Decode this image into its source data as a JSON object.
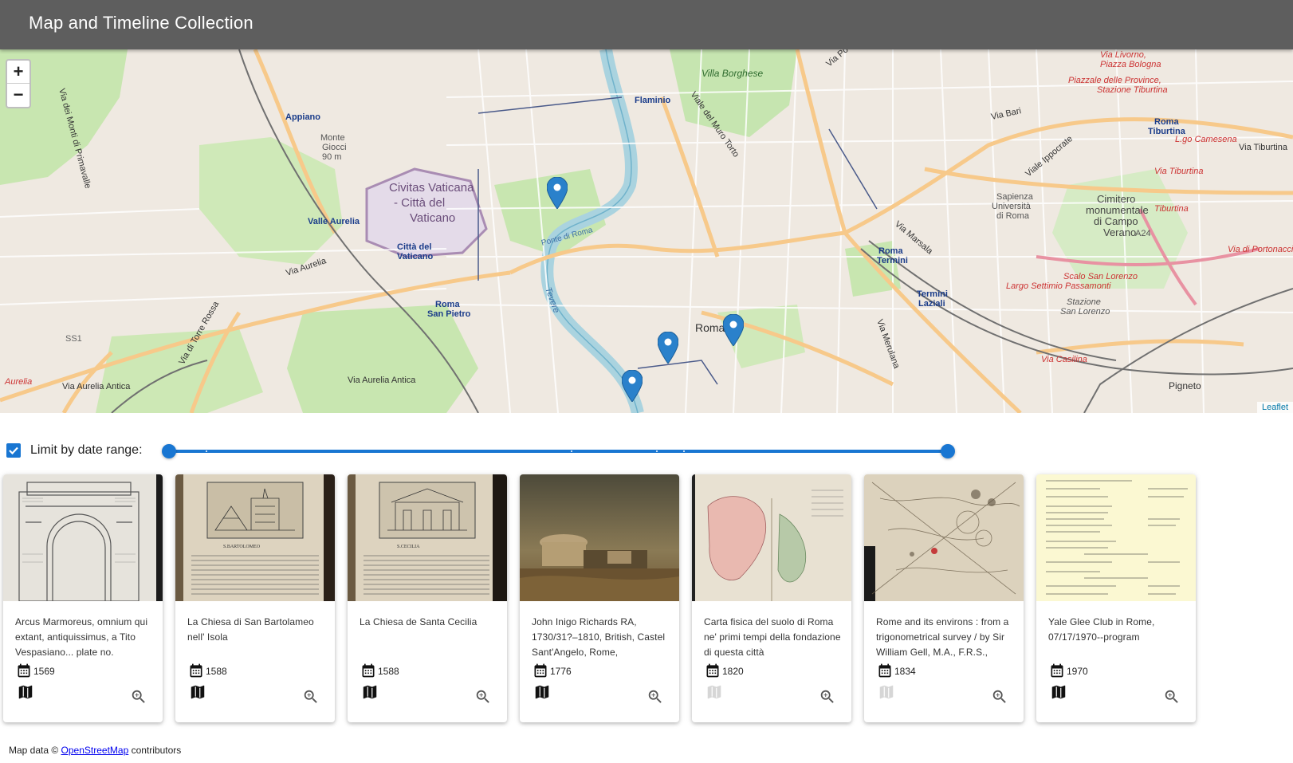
{
  "app": {
    "title": "Map and Timeline Collection"
  },
  "map": {
    "zoom_in_label": "+",
    "zoom_out_label": "−",
    "attribution": "Leaflet",
    "labels": [
      "Villa Borghese",
      "Flaminio",
      "Appiano",
      "Monte Gioco 90 m",
      "Civitas Vaticana - Città del Vaticano",
      "Valle Aurelia",
      "Città del Vaticano",
      "Via Aurelia",
      "Roma San Pietro",
      "SS1",
      "Aurelia",
      "Via Aurelia Antica",
      "Via di Torre Rossa",
      "Roma",
      "Tevere",
      "Ponte di Roma",
      "Roma Termini",
      "Termini Laziali",
      "Via Merulana",
      "Sapienza Università di Roma",
      "Cimitero monumentale di Campo Verano",
      "Via Tiburtina",
      "Roma Tiburtina",
      "Scalo San Lorenzo",
      "Largo Settimio Passamonti",
      "Stazione San Lorenzo",
      "Via Casilina",
      "Pigneto",
      "Via Bari",
      "Viale Ippocrate",
      "Piazzale delle Province, Stazione Tiburtina",
      "Via Livorno, Piazza Bologna",
      "L.go Camesena",
      "A24",
      "Via di Portonaccio",
      "Via Marsala",
      "Viale del Muro Torto",
      "Via Po",
      "Via dei Monti di Primavalle"
    ],
    "marker_count": 4
  },
  "filter": {
    "checkbox_checked": true,
    "label": "Limit by date range:",
    "range_min_fraction": 0.0,
    "range_max_fraction": 1.0
  },
  "cards": [
    {
      "title": "Arcus Marmoreus, omnium qui extant, antiquissimus, a Tito Vespasiano... plate no.",
      "year": "1569",
      "has_location": true
    },
    {
      "title": "La Chiesa di San Bartolameo nell' Isola",
      "year": "1588",
      "has_location": true
    },
    {
      "title": "La Chiesa de Santa Cecilia",
      "year": "1588",
      "has_location": true
    },
    {
      "title": "John Inigo Richards RA, 1730/31?–1810, British, Castel Sant'Angelo, Rome,",
      "year": "1776",
      "has_location": true
    },
    {
      "title": "Carta fisica del suolo di Roma ne' primi tempi della fondazione di questa città",
      "year": "1820",
      "has_location": false
    },
    {
      "title": "Rome and its environs : from a trigonometrical survey / by Sir William Gell, M.A., F.R.S.,",
      "year": "1834",
      "has_location": false
    },
    {
      "title": "Yale Glee Club in Rome, 07/17/1970--program",
      "year": "1970",
      "has_location": true
    }
  ],
  "footer": {
    "prefix": "Map data © ",
    "link": "OpenStreetMap",
    "suffix": " contributors"
  },
  "colors": {
    "appbar": "#5e5e5e",
    "primary": "#1976d2",
    "map_land": "#efe9e1",
    "map_park": "#c8e6b0",
    "map_water": "#aad3df",
    "map_road_major": "#f7c98a",
    "map_road_minor": "#ffffff"
  },
  "icons": [
    "calendar-icon",
    "map-icon",
    "zoom-in-icon",
    "map-marker-icon",
    "check-icon"
  ]
}
